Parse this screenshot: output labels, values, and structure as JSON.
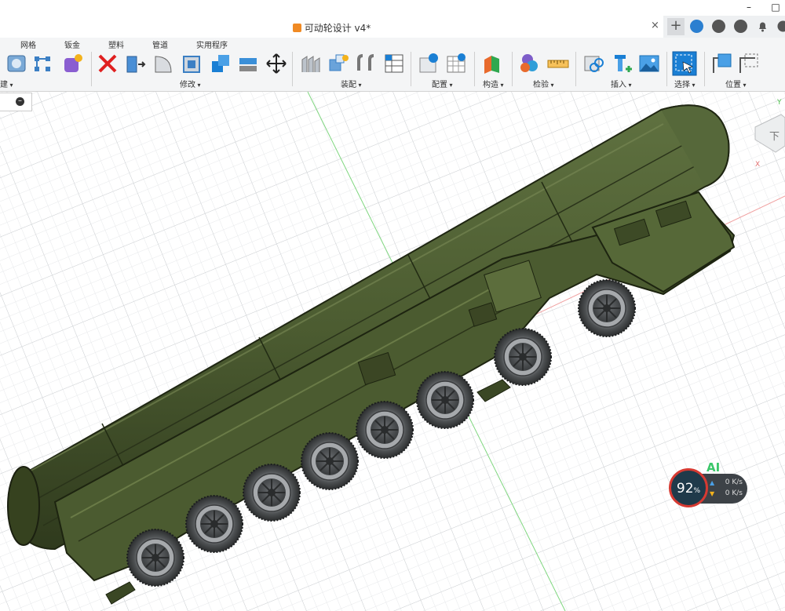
{
  "window": {
    "minimize": "–",
    "maximize": "□"
  },
  "tab": {
    "title": "可动轮设计 v4*",
    "close": "×",
    "new_tab": "+"
  },
  "toolbar": {
    "tabs": [
      "网格",
      "钣金",
      "塑料",
      "管道",
      "实用程序"
    ],
    "groups": {
      "create": "建",
      "modify": "修改",
      "assemble": "装配",
      "configure": "配置",
      "construct": "构造",
      "inspect": "检验",
      "insert": "插入",
      "select": "选择",
      "position": "位置"
    }
  },
  "browser": {
    "collapse": "–"
  },
  "viewcube": {
    "face": "下",
    "axis_x": "X",
    "axis_y": "Y"
  },
  "network_widget": {
    "label": "AI",
    "cpu_percent": "92",
    "percent_sign": "%",
    "upload": "0 K/s",
    "download": "0 K/s"
  },
  "colors": {
    "accent": "#1a7fd4",
    "vehicle_green": "#4e5e32",
    "grid": "#d9dbdd"
  }
}
